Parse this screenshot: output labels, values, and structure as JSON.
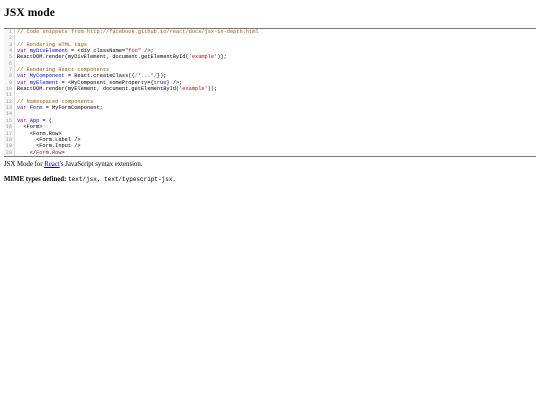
{
  "page": {
    "title": "JSX mode"
  },
  "editor": {
    "lines": [
      {
        "num": "1",
        "tokens": [
          {
            "t": "// Code snippets from http://facebook.github.io/react/docs/jsx-in-depth.html",
            "c": "comment"
          }
        ]
      },
      {
        "num": "2",
        "tokens": []
      },
      {
        "num": "3",
        "tokens": [
          {
            "t": "// Rendering HTML tags",
            "c": "comment"
          }
        ]
      },
      {
        "num": "4",
        "tokens": [
          {
            "t": "var ",
            "c": "keyword"
          },
          {
            "t": "myDivElement",
            "c": "def"
          },
          {
            "t": " = <",
            "c": "plain"
          },
          {
            "t": "div",
            "c": "plain"
          },
          {
            "t": " className=",
            "c": "plain"
          },
          {
            "t": "\"foo\"",
            "c": "string"
          },
          {
            "t": " />;",
            "c": "plain"
          }
        ]
      },
      {
        "num": "5",
        "tokens": [
          {
            "t": "ReactDOM.render(myDivElement, document.getElementById(",
            "c": "plain"
          },
          {
            "t": "'example'",
            "c": "string"
          },
          {
            "t": "));",
            "c": "plain"
          }
        ]
      },
      {
        "num": "6",
        "tokens": []
      },
      {
        "num": "7",
        "tokens": [
          {
            "t": "// Rendering React components",
            "c": "comment"
          }
        ]
      },
      {
        "num": "8",
        "tokens": [
          {
            "t": "var ",
            "c": "keyword"
          },
          {
            "t": "MyComponent",
            "c": "def"
          },
          {
            "t": " = React.createClass({",
            "c": "plain"
          },
          {
            "t": "/*...*/",
            "c": "comment"
          },
          {
            "t": "});",
            "c": "plain"
          }
        ]
      },
      {
        "num": "9",
        "tokens": [
          {
            "t": "var ",
            "c": "keyword"
          },
          {
            "t": "myElement",
            "c": "def"
          },
          {
            "t": " = <MyComponent someProperty={",
            "c": "plain"
          },
          {
            "t": "true",
            "c": "atom"
          },
          {
            "t": "} />;",
            "c": "plain"
          }
        ]
      },
      {
        "num": "10",
        "tokens": [
          {
            "t": "ReactDOM.render(myElement, document.getElementById(",
            "c": "plain"
          },
          {
            "t": "'example'",
            "c": "string"
          },
          {
            "t": "));",
            "c": "plain"
          }
        ]
      },
      {
        "num": "11",
        "tokens": []
      },
      {
        "num": "12",
        "tokens": [
          {
            "t": "// Namespaced components",
            "c": "comment"
          }
        ]
      },
      {
        "num": "13",
        "tokens": [
          {
            "t": "var ",
            "c": "keyword"
          },
          {
            "t": "Form",
            "c": "def"
          },
          {
            "t": " = MyFormComponent;",
            "c": "plain"
          }
        ]
      },
      {
        "num": "14",
        "tokens": []
      },
      {
        "num": "15",
        "tokens": [
          {
            "t": "var ",
            "c": "keyword"
          },
          {
            "t": "App",
            "c": "def"
          },
          {
            "t": " = (",
            "c": "plain"
          }
        ]
      },
      {
        "num": "16",
        "tokens": [
          {
            "t": "  <Form>",
            "c": "plain"
          }
        ]
      },
      {
        "num": "17",
        "tokens": [
          {
            "t": "    <Form.Row>",
            "c": "plain"
          }
        ]
      },
      {
        "num": "18",
        "tokens": [
          {
            "t": "      <Form.Label />",
            "c": "plain"
          }
        ]
      },
      {
        "num": "19",
        "tokens": [
          {
            "t": "      <Form.Input />",
            "c": "plain"
          }
        ]
      },
      {
        "num": "20",
        "tokens": [
          {
            "t": "    </",
            "c": "plain"
          },
          {
            "t": "Form.Row",
            "c": "string"
          },
          {
            "t": ">",
            "c": "plain"
          }
        ]
      }
    ]
  },
  "description": {
    "prefix": "JSX Mode for ",
    "link": "React",
    "suffix": "'s JavaScript syntax extension."
  },
  "mime": {
    "label": "MIME types defined:",
    "values": "text/jsx, text/typescript-jsx."
  }
}
